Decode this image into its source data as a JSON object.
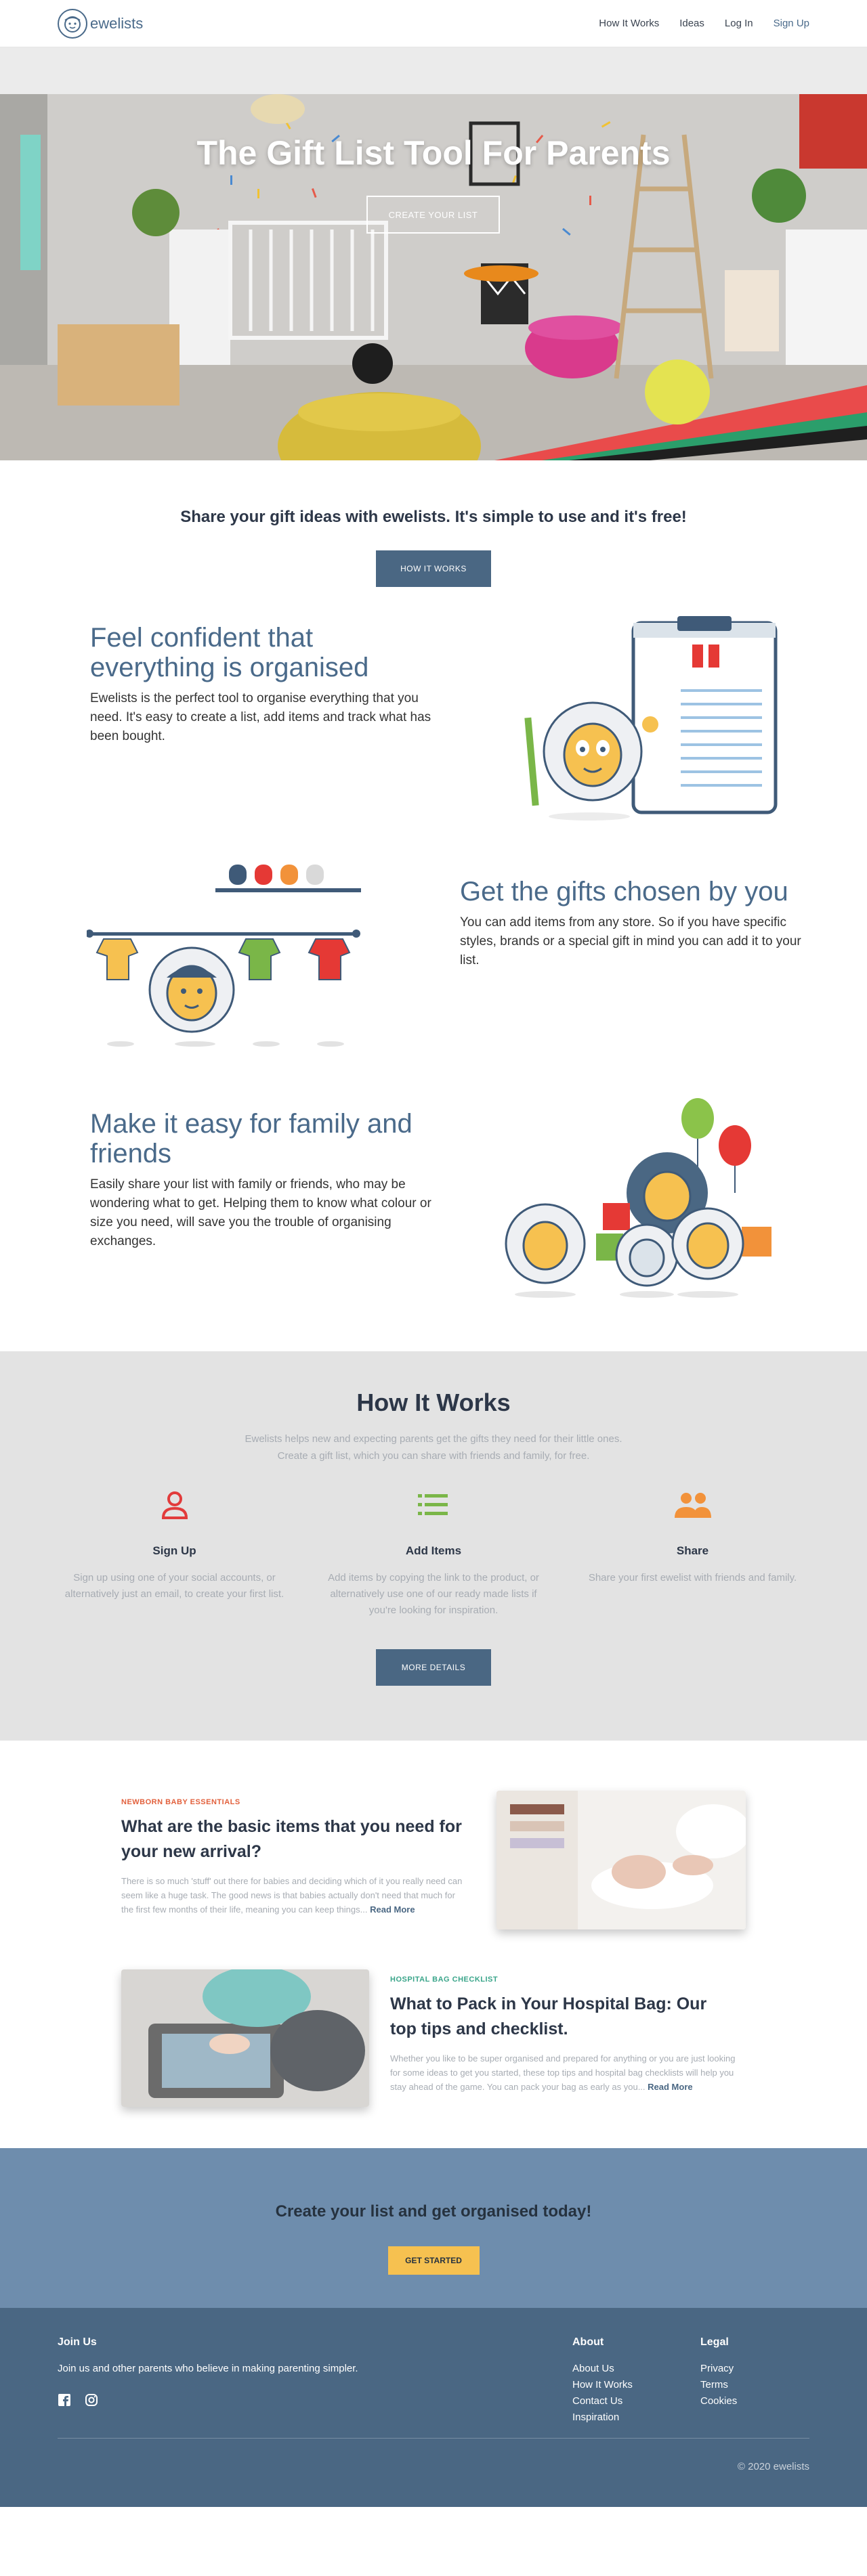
{
  "nav": {
    "logo_text": "ewelists",
    "links": [
      "How It Works",
      "Ideas",
      "Log In",
      "Sign Up"
    ]
  },
  "hero": {
    "title": "The Gift List Tool For Parents",
    "button": "CREATE YOUR LIST"
  },
  "intro": {
    "headline": "Share your gift ideas with ewelists. It's simple to use and it's free!",
    "button": "HOW IT WORKS"
  },
  "features": [
    {
      "title": "Feel confident that everything is organised",
      "body": "Ewelists is the perfect tool to organise everything that you need. It's easy to create a list, add items and track what has been bought."
    },
    {
      "title": "Get the gifts chosen by you",
      "body": "You can add items from any store. So if you have specific styles, brands or a special gift in mind you can add it to your list."
    },
    {
      "title": "Make it easy for family and friends",
      "body": "Easily share your list with family or friends, who may be wondering what to get. Helping them to know what colour or size you need, will save you the trouble of organising exchanges."
    }
  ],
  "how_it_works": {
    "title": "How It Works",
    "subtitle_line1": "Ewelists helps new and expecting parents get the gifts they need for their little ones.",
    "subtitle_line2": "Create a gift list, which you can share with friends and family, for free.",
    "steps": [
      {
        "icon": "user-icon",
        "color": "#e23b3b",
        "title": "Sign Up",
        "body": "Sign up using one of your social accounts, or alternatively just an email, to create your first list."
      },
      {
        "icon": "list-icon",
        "color": "#7ab648",
        "title": "Add Items",
        "body": "Add items by copying the link to the product, or alternatively use one of our ready made lists if you're looking for inspiration."
      },
      {
        "icon": "people-icon",
        "color": "#f2923a",
        "title": "Share",
        "body": "Share your first ewelist with friends and family."
      }
    ],
    "button": "MORE DETAILS"
  },
  "articles": [
    {
      "category": "NEWBORN BABY ESSENTIALS",
      "category_color": "#e2603c",
      "title": "What are the basic items that you need for your new arrival?",
      "excerpt": "There is so much 'stuff' out there for babies and deciding which of it you really need can seem like a huge task. The good news is that babies actually don't need that much for the first few months of their life, meaning you can keep things...",
      "more": "Read More"
    },
    {
      "category": "HOSPITAL BAG CHECKLIST",
      "category_color": "#3aa58a",
      "title": "What to Pack in Your Hospital Bag: Our top tips and checklist.",
      "excerpt": "Whether you like to be super organised and prepared for anything or you are just looking for some ideas to get you started, these top tips and hospital bag checklists will help you stay ahead of the game. You can pack your bag as early as you...",
      "more": "Read More"
    }
  ],
  "cta": {
    "headline": "Create your list and get organised today!",
    "button": "GET STARTED"
  },
  "footer": {
    "join_title": "Join Us",
    "join_body": "Join us and other parents who believe in making parenting simpler.",
    "about_title": "About",
    "about_links": [
      "About Us",
      "How It Works",
      "Contact Us",
      "Inspiration"
    ],
    "legal_title": "Legal",
    "legal_links": [
      "Privacy",
      "Terms",
      "Cookies"
    ],
    "copyright": "© 2020 ewelists",
    "social_icons": [
      "facebook-icon",
      "instagram-icon"
    ]
  }
}
